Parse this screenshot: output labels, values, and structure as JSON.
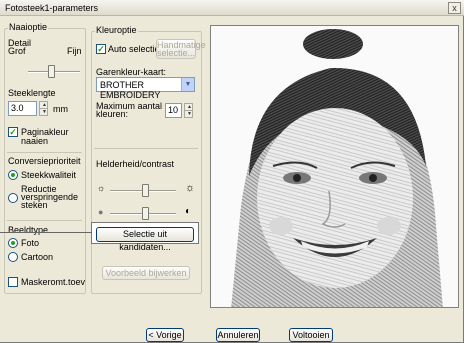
{
  "window": {
    "title": "Fotosteek1-parameters",
    "close_glyph": "x"
  },
  "left": {
    "naaioptie": "Naaioptie",
    "detail_label": "Detail",
    "grof": "Grof",
    "fijn": "Fijn",
    "detail_level": 0.45,
    "steeklengte_label": "Steeklengte",
    "steeklengte_value": "3.0",
    "steeklengte_unit": "mm",
    "paginakleur_label_1": "Paginakleur",
    "paginakleur_label_2": "naaien",
    "paginakleur_checked": true,
    "conversie_title": "Conversieprioriteit",
    "steekkwaliteit": "Steekkwaliteit",
    "reductie_1": "Reductie",
    "reductie_2": "verspringende",
    "reductie_3": "steken",
    "beeldtype_title": "Beeldtype",
    "foto": "Foto",
    "cartoon": "Cartoon",
    "maskeromt": "Maskeromt.toev"
  },
  "middle": {
    "kleuroptie": "Kleuroptie",
    "auto_selectie": "Auto selectie",
    "auto_selectie_checked": true,
    "handmatige_1": "Handmatige",
    "handmatige_2": "selectie...",
    "garenkleur_label": "Garenkleur-kaart:",
    "garenkleur_value": "BROTHER EMBROIDERY",
    "max_label_1": "Maximum aantal",
    "max_label_2": "kleuren:",
    "max_value": "10",
    "helderheid_title": "Helderheid/contrast",
    "brightness_level": 0.55,
    "contrast_level": 0.55,
    "selectie_button": "Selectie uit kandidaten...",
    "voorbeeld_button": "Voorbeeld bijwerken"
  },
  "footer": {
    "vorige": "< Vorige",
    "annuleren": "Annuleren",
    "voltooien": "Voltooien"
  },
  "icons": {
    "sun_small": "☼",
    "sun_large": "☼",
    "contrast_low": "●",
    "contrast_high": "◐"
  }
}
